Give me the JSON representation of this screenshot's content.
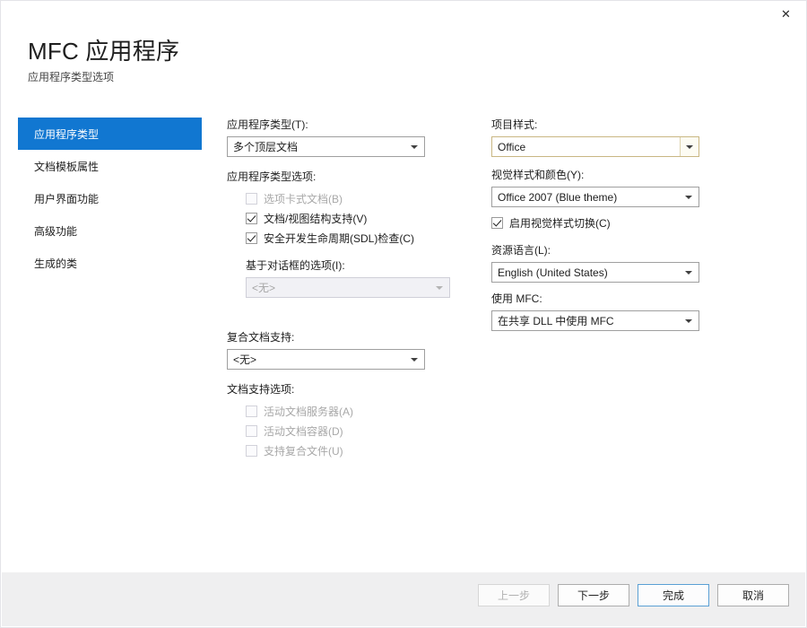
{
  "window": {
    "close_label": "✕"
  },
  "header": {
    "title": "MFC 应用程序",
    "subtitle": "应用程序类型选项"
  },
  "sidebar": {
    "items": [
      {
        "label": "应用程序类型",
        "selected": true
      },
      {
        "label": "文档模板属性",
        "selected": false
      },
      {
        "label": "用户界面功能",
        "selected": false
      },
      {
        "label": "高级功能",
        "selected": false
      },
      {
        "label": "生成的类",
        "selected": false
      }
    ]
  },
  "left_column": {
    "app_type_label": "应用程序类型(T):",
    "app_type_value": "多个顶层文档",
    "app_type_options_label": "应用程序类型选项:",
    "checkbox_tabbed": "选项卡式文档(B)",
    "checkbox_docview": "文档/视图结构支持(V)",
    "checkbox_sdl": "安全开发生命周期(SDL)检查(C)",
    "dialog_options_label": "基于对话框的选项(I):",
    "dialog_options_value": "<无>",
    "compound_label": "复合文档支持:",
    "compound_value": "<无>",
    "doc_support_label": "文档支持选项:",
    "checkbox_activedoc_server": "活动文档服务器(A)",
    "checkbox_activedoc_container": "活动文档容器(D)",
    "checkbox_compound_files": "支持复合文件(U)"
  },
  "right_column": {
    "project_style_label": "项目样式:",
    "project_style_value": "Office",
    "visual_style_label": "视觉样式和颜色(Y):",
    "visual_style_value": "Office 2007 (Blue theme)",
    "checkbox_enable_switch": "启用视觉样式切换(C)",
    "resource_lang_label": "资源语言(L):",
    "resource_lang_value": "English (United States)",
    "use_mfc_label": "使用 MFC:",
    "use_mfc_value": "在共享 DLL 中使用 MFC"
  },
  "footer": {
    "back": "上一步",
    "next": "下一步",
    "finish": "完成",
    "cancel": "取消"
  },
  "colors": {
    "accent_blue": "#1177d1",
    "focus_gold": "#c9b783",
    "focus_blue": "#5a9fd4",
    "footer_bg": "#efeff0"
  }
}
